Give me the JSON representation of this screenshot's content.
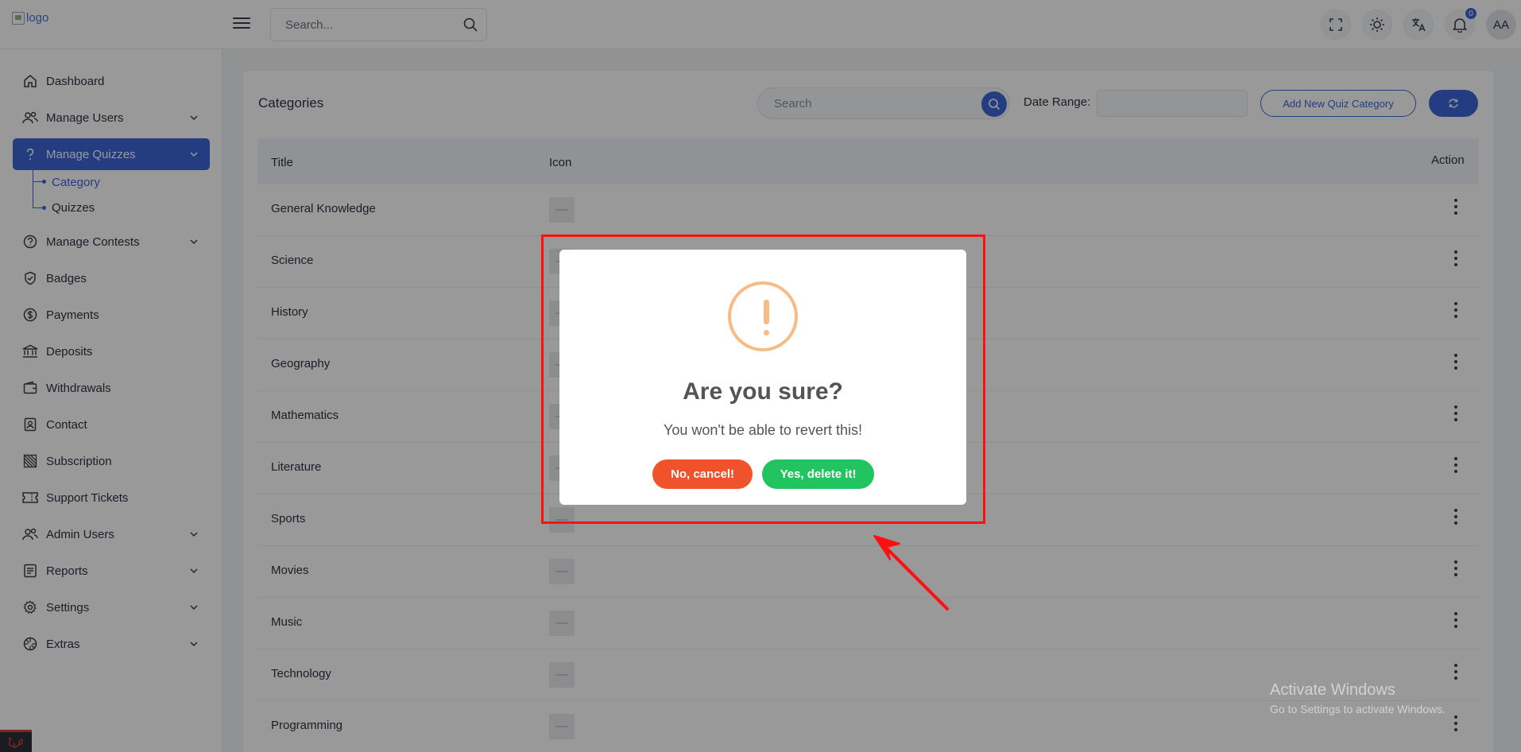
{
  "header": {
    "logo_alt": "logo",
    "search_placeholder": "Search...",
    "notification_count": "0",
    "avatar_initials": "AA"
  },
  "sidebar": {
    "items": [
      {
        "label": "Dashboard",
        "icon": "home-icon"
      },
      {
        "label": "Manage Users",
        "icon": "users-icon",
        "has_children": true
      },
      {
        "label": "Manage Quizzes",
        "icon": "question-icon",
        "has_children": true,
        "active": true
      },
      {
        "label": "Manage Contests",
        "icon": "contest-icon",
        "has_children": true
      },
      {
        "label": "Badges",
        "icon": "badge-icon"
      },
      {
        "label": "Payments",
        "icon": "dollar-icon"
      },
      {
        "label": "Deposits",
        "icon": "bank-icon"
      },
      {
        "label": "Withdrawals",
        "icon": "wallet-icon"
      },
      {
        "label": "Contact",
        "icon": "contact-icon"
      },
      {
        "label": "Subscription",
        "icon": "subscription-icon"
      },
      {
        "label": "Support Tickets",
        "icon": "ticket-icon"
      },
      {
        "label": "Admin Users",
        "icon": "admin-users-icon",
        "has_children": true
      },
      {
        "label": "Reports",
        "icon": "report-icon",
        "has_children": true
      },
      {
        "label": "Settings",
        "icon": "gear-icon",
        "has_children": true
      },
      {
        "label": "Extras",
        "icon": "extras-icon",
        "has_children": true
      }
    ],
    "submenu": [
      {
        "label": "Category",
        "active": true
      },
      {
        "label": "Quizzes"
      }
    ]
  },
  "page": {
    "title": "Categories",
    "search_placeholder": "Search",
    "date_range_label": "Date Range:",
    "add_button": "Add New Quiz Category"
  },
  "table": {
    "columns": [
      "Title",
      "Icon",
      "Action"
    ],
    "rows": [
      "General Knowledge",
      "Science",
      "History",
      "Geography",
      "Mathematics",
      "Literature",
      "Sports",
      "Movies",
      "Music",
      "Technology",
      "Programming"
    ]
  },
  "modal": {
    "title": "Are you sure?",
    "text": "You won't be able to revert this!",
    "cancel_label": "No, cancel!",
    "confirm_label": "Yes, delete it!",
    "icon": "warning-icon"
  },
  "watermark": {
    "line1": "Activate Windows",
    "line2": "Go to Settings to activate Windows."
  },
  "colors": {
    "primary": "#3d67d8",
    "cancel": "#f0522c",
    "confirm": "#21c45e",
    "warning": "#f8bb86",
    "annotation": "#ff1010"
  }
}
